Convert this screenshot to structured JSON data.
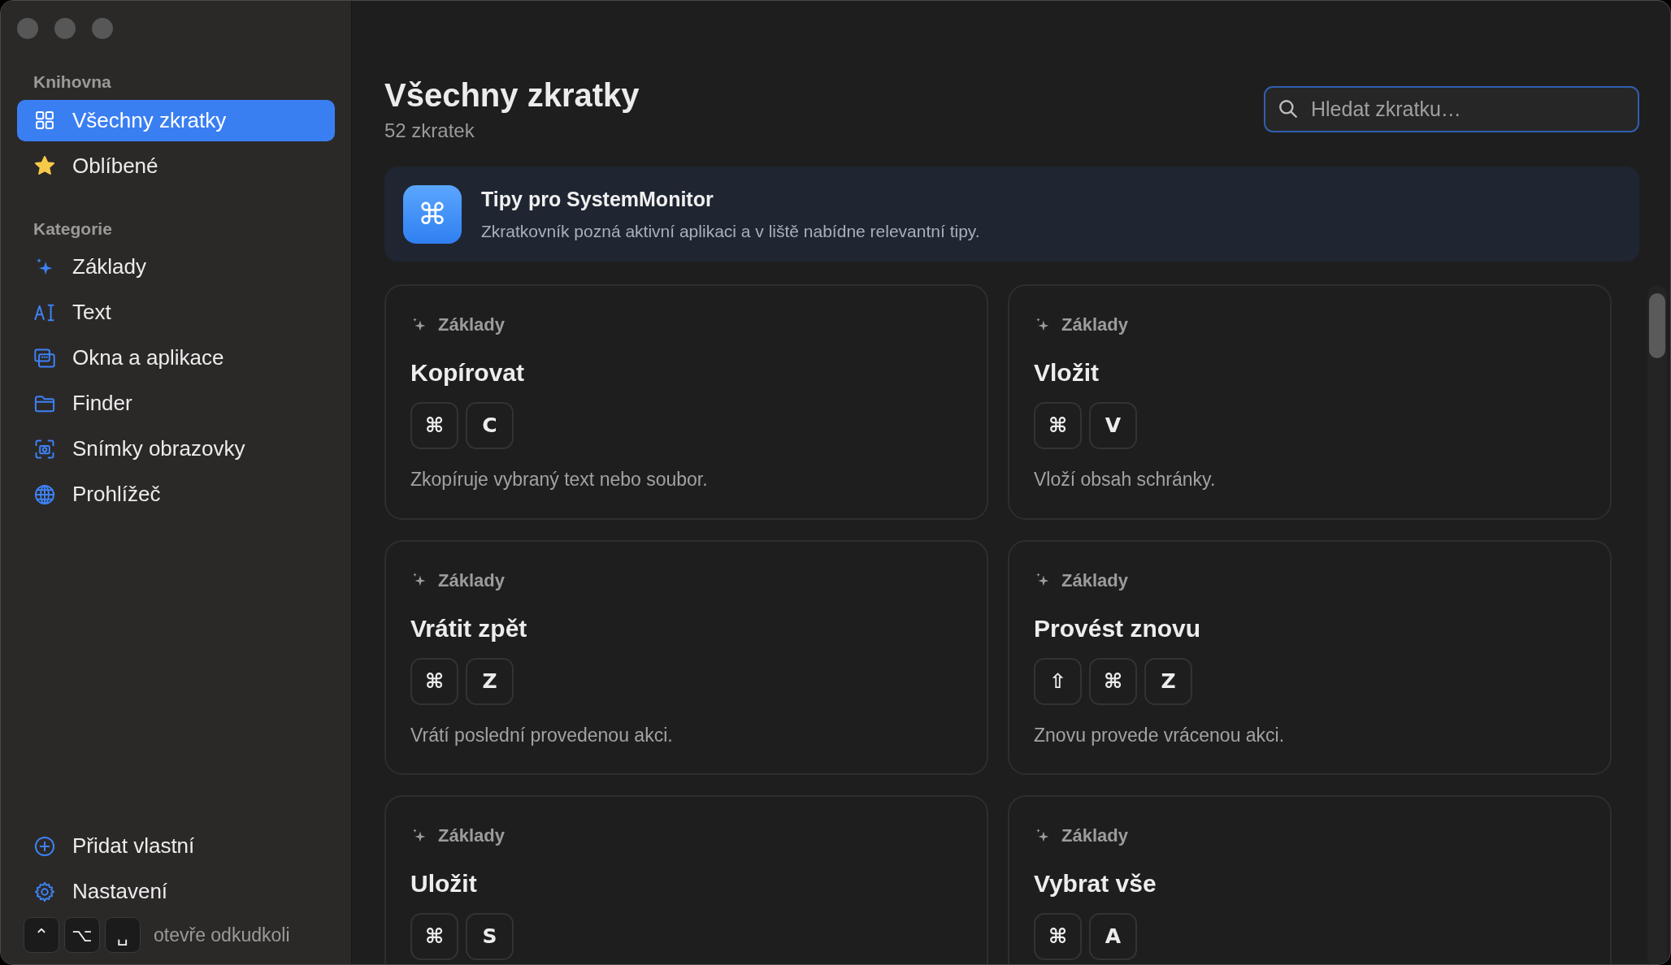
{
  "sidebar": {
    "sections": [
      {
        "heading": "Knihovna",
        "items": [
          {
            "label": "Všechny zkratky",
            "selected": true
          },
          {
            "label": "Oblíbené",
            "selected": false
          }
        ]
      },
      {
        "heading": "Kategorie",
        "items": [
          {
            "label": "Základy",
            "selected": false
          },
          {
            "label": "Text",
            "selected": false
          },
          {
            "label": "Okna a aplikace",
            "selected": false
          },
          {
            "label": "Finder",
            "selected": false
          },
          {
            "label": "Snímky obrazovky",
            "selected": false
          },
          {
            "label": "Prohlížeč",
            "selected": false
          }
        ]
      }
    ],
    "footer_items": [
      {
        "label": "Přidat vlastní"
      },
      {
        "label": "Nastavení"
      }
    ],
    "hotkey": {
      "keys": [
        "⌃",
        "⌥",
        "␣"
      ],
      "caption": "otevře odkudkoli"
    }
  },
  "header": {
    "title": "Všechny zkratky",
    "count": "52 zkratek"
  },
  "search": {
    "placeholder": "Hledat zkratku…"
  },
  "tip": {
    "glyph": "⌘",
    "title": "Tipy pro SystemMonitor",
    "text": "Zkratkovník pozná aktivní aplikaci a v liště nabídne relevantní tipy."
  },
  "shortcuts": [
    {
      "category": "Základy",
      "title": "Kopírovat",
      "keys": [
        "⌘",
        "C"
      ],
      "description": "Zkopíruje vybraný text nebo soubor."
    },
    {
      "category": "Základy",
      "title": "Vložit",
      "keys": [
        "⌘",
        "V"
      ],
      "description": "Vloží obsah schránky."
    },
    {
      "category": "Základy",
      "title": "Vrátit zpět",
      "keys": [
        "⌘",
        "Z"
      ],
      "description": "Vrátí poslední provedenou akci."
    },
    {
      "category": "Základy",
      "title": "Provést znovu",
      "keys": [
        "⇧",
        "⌘",
        "Z"
      ],
      "description": "Znovu provede vrácenou akci."
    },
    {
      "category": "Základy",
      "title": "Uložit",
      "keys": [
        "⌘",
        "S"
      ]
    },
    {
      "category": "Základy",
      "title": "Vybrat vše",
      "keys": [
        "⌘",
        "A"
      ]
    }
  ]
}
